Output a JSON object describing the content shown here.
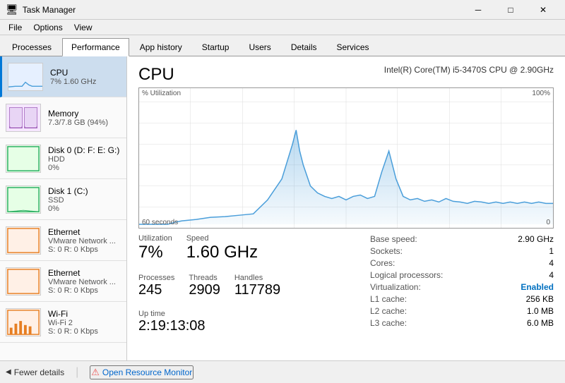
{
  "window": {
    "title": "Task Manager",
    "icon": "🖥"
  },
  "titlebar": {
    "minimize": "─",
    "maximize": "□",
    "close": "✕"
  },
  "menu": {
    "items": [
      "File",
      "Options",
      "View"
    ]
  },
  "tabs": [
    {
      "id": "processes",
      "label": "Processes"
    },
    {
      "id": "performance",
      "label": "Performance",
      "active": true
    },
    {
      "id": "app-history",
      "label": "App history"
    },
    {
      "id": "startup",
      "label": "Startup"
    },
    {
      "id": "users",
      "label": "Users"
    },
    {
      "id": "details",
      "label": "Details"
    },
    {
      "id": "services",
      "label": "Services"
    }
  ],
  "sidebar": {
    "items": [
      {
        "id": "cpu",
        "name": "CPU",
        "sub1": "7% 1.60 GHz",
        "sub2": "",
        "active": true,
        "chartType": "cpu"
      },
      {
        "id": "memory",
        "name": "Memory",
        "sub1": "7.3/7.8 GB (94%)",
        "sub2": "",
        "active": false,
        "chartType": "memory"
      },
      {
        "id": "disk0",
        "name": "Disk 0 (D: F: E: G:)",
        "sub1": "HDD",
        "sub2": "0%",
        "active": false,
        "chartType": "disk"
      },
      {
        "id": "disk1",
        "name": "Disk 1 (C:)",
        "sub1": "SSD",
        "sub2": "0%",
        "active": false,
        "chartType": "disk"
      },
      {
        "id": "ethernet0",
        "name": "Ethernet",
        "sub1": "VMware Network ...",
        "sub2": "S: 0  R: 0 Kbps",
        "active": false,
        "chartType": "network"
      },
      {
        "id": "ethernet1",
        "name": "Ethernet",
        "sub1": "VMware Network ...",
        "sub2": "S: 0  R: 0 Kbps",
        "active": false,
        "chartType": "network"
      },
      {
        "id": "wifi",
        "name": "Wi-Fi",
        "sub1": "Wi-Fi 2",
        "sub2": "S: 0  R: 0 Kbps",
        "active": false,
        "chartType": "wifi"
      }
    ]
  },
  "cpu": {
    "title": "CPU",
    "model": "Intel(R) Core(TM) i5-3470S CPU @ 2.90GHz",
    "chart": {
      "y_label": "% Utilization",
      "y_max": "100%",
      "y_min": "0",
      "x_label": "60 seconds"
    },
    "stats": {
      "utilization_label": "Utilization",
      "utilization_value": "7%",
      "speed_label": "Speed",
      "speed_value": "1.60 GHz",
      "processes_label": "Processes",
      "processes_value": "245",
      "threads_label": "Threads",
      "threads_value": "2909",
      "handles_label": "Handles",
      "handles_value": "117789",
      "uptime_label": "Up time",
      "uptime_value": "2:19:13:08"
    },
    "right_stats": [
      {
        "label": "Base speed:",
        "value": "2.90 GHz",
        "highlight": false
      },
      {
        "label": "Sockets:",
        "value": "1",
        "highlight": false
      },
      {
        "label": "Cores:",
        "value": "4",
        "highlight": false
      },
      {
        "label": "Logical processors:",
        "value": "4",
        "highlight": false
      },
      {
        "label": "Virtualization:",
        "value": "Enabled",
        "highlight": true
      },
      {
        "label": "L1 cache:",
        "value": "256 KB",
        "highlight": false
      },
      {
        "label": "L2 cache:",
        "value": "1.0 MB",
        "highlight": false
      },
      {
        "label": "L3 cache:",
        "value": "6.0 MB",
        "highlight": false
      }
    ]
  },
  "bottom": {
    "fewer_details": "Fewer details",
    "open_resource_monitor": "Open Resource Monitor"
  },
  "colors": {
    "cpu_line": "#4a9eda",
    "cpu_fill": "#c8e4f5",
    "cpu_chart_border": "#0078d7",
    "accent": "#0078d7"
  }
}
